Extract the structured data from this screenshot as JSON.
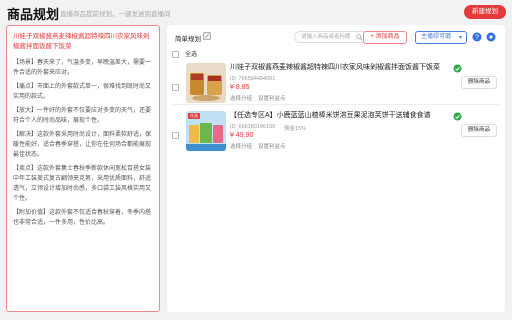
{
  "header": {
    "title": "商品规划",
    "subtitle": "直播商品提前规划，一键发送到直播间",
    "new_button": "新建规划"
  },
  "left": {
    "title": "川娃子双椒酱燕麦辣椒酱超特辣四川农家风味剁椒酱拌面饭酱下饭菜",
    "paragraphs": [
      "【场景】春天来了，气温多变，早晚温差大，需要一件合适的外套来应对。",
      "【痛点】市面上的外套款式单一，很难找到既时尚又实用的款式。",
      "【放大】一件好的外套不仅要应对多变的天气，还要符合个人的时尚品味，展现个性。",
      "【解决】这款外套采用时尚设计，面料柔软舒适，保暖性能好，适合春季穿搭，让你在任何场合都能展现最佳状态。",
      "【卖点】这款外套集士春秋季新款休闲宽松百搭女装中年工装美式复古翻领夹克男，采用优质面料，舒适透气，立领设计增加时尚感，多口袋工装风格实用又个性。",
      "【附加价值】这款外套不仅适合春秋穿着，冬季内搭也非常合适，一件多用，性价比高。"
    ]
  },
  "toolbar": {
    "plan_label": "简单规划",
    "search_placeholder": "请输入商品或者标题",
    "add_label": "+ 添加商品",
    "anchor_label": "主播缪可璐",
    "select_all": "全选"
  },
  "products": [
    {
      "title": "川娃子双椒酱燕麦辣椒酱超特辣四川农家风味剁椒酱拌面饭酱下饭菜",
      "id": "ID: 766594484091",
      "commission": "",
      "price": "¥ 8.85",
      "links": [
        "选择分组",
        "设置利益点"
      ],
      "delete": "删除商品"
    },
    {
      "title": "【任选专区A】小鹿蓝蓝山楂棒米饼溶豆果泥泡芙饼干送辅食食谱",
      "id": "ID: 668180196150",
      "commission": "佣金15%",
      "price": "¥ 49.90",
      "links": [
        "选择分组",
        "设置利益点"
      ],
      "delete": "删除商品"
    }
  ],
  "colors": {
    "accent": "#e23b3b",
    "blue": "#4a7fd8",
    "success": "#2ea84a"
  }
}
